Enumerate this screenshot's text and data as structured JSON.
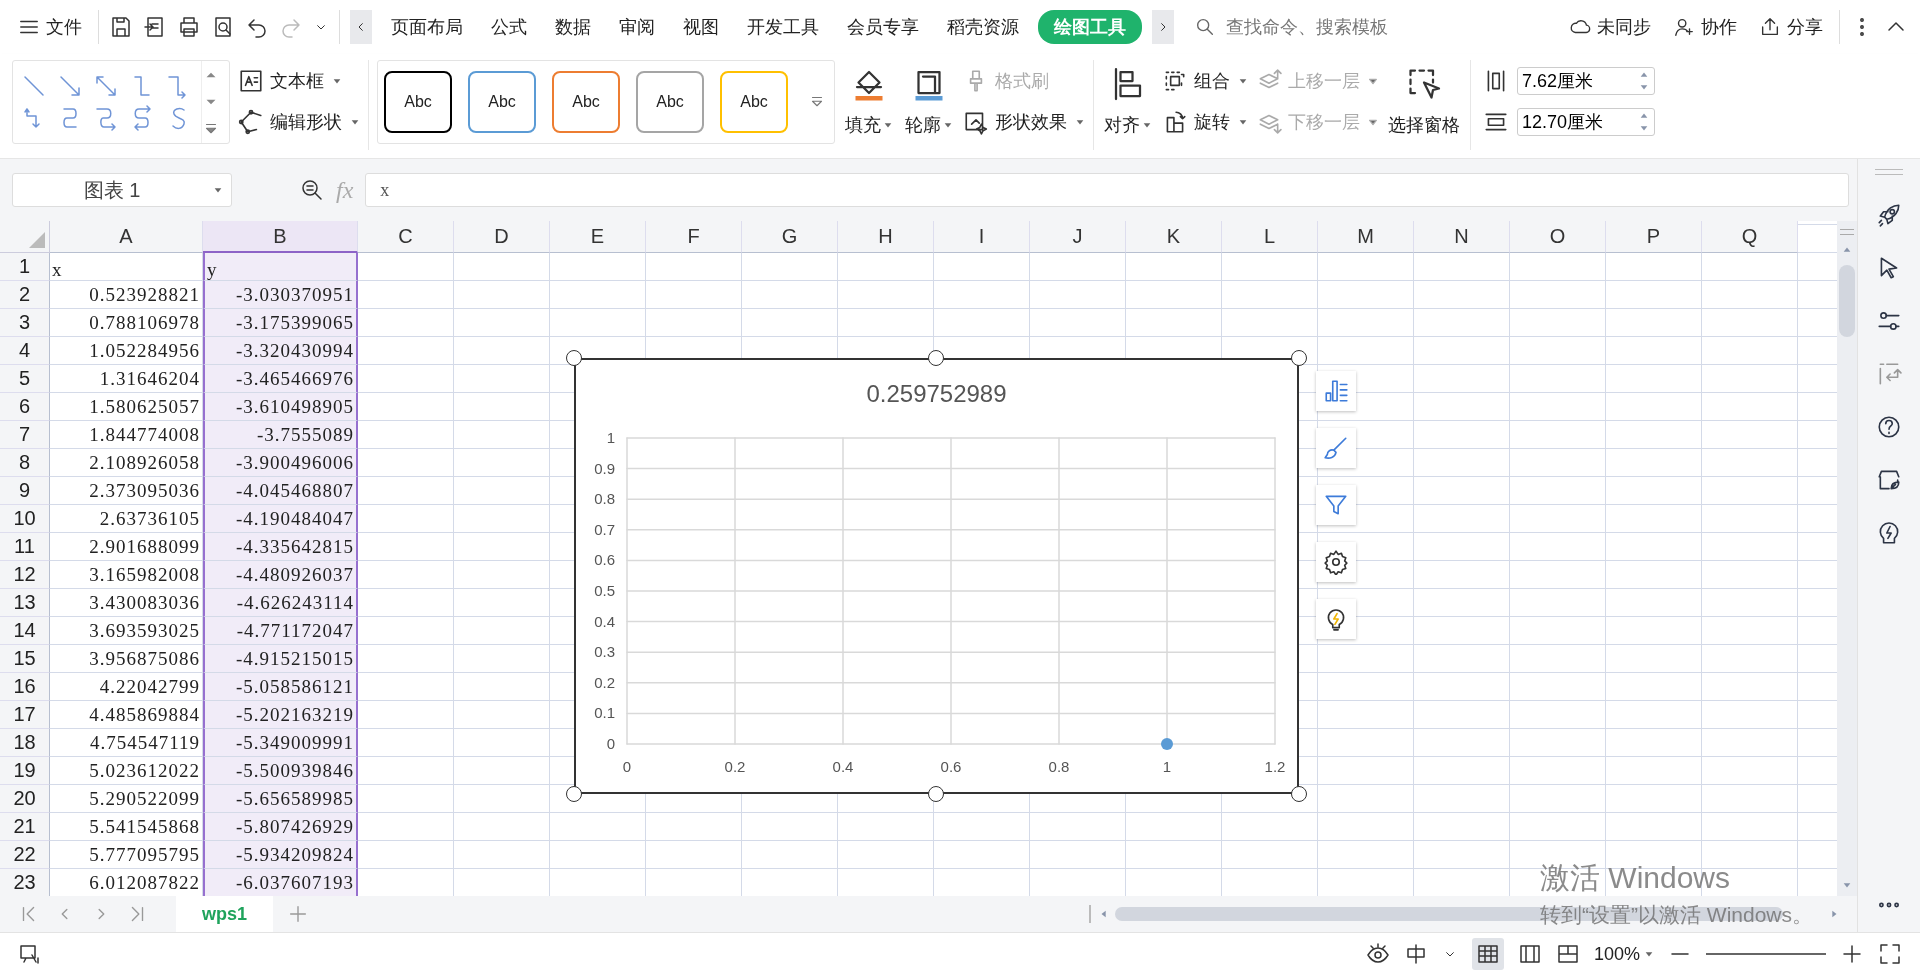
{
  "menu_bar": {
    "file": "文件",
    "tabs": [
      {
        "label": "页面布局",
        "selected": false
      },
      {
        "label": "公式",
        "selected": false
      },
      {
        "label": "数据",
        "selected": false
      },
      {
        "label": "审阅",
        "selected": false
      },
      {
        "label": "视图",
        "selected": false
      },
      {
        "label": "开发工具",
        "selected": false
      },
      {
        "label": "会员专享",
        "selected": false
      },
      {
        "label": "稻壳资源",
        "selected": false
      },
      {
        "label": "绘图工具",
        "selected": true
      }
    ],
    "search": {
      "placeholder": "查找命令、搜索模板"
    },
    "actions": [
      "未同步",
      "协作",
      "分享"
    ]
  },
  "ribbon": {
    "text_box": "文本框",
    "edit_shape": "编辑形状",
    "styles": [
      {
        "label": "Abc",
        "color": "#000000"
      },
      {
        "label": "Abc",
        "color": "#5b9bd5"
      },
      {
        "label": "Abc",
        "color": "#ed7d31"
      },
      {
        "label": "Abc",
        "color": "#a5a5a5"
      },
      {
        "label": "Abc",
        "color": "#ffc000"
      }
    ],
    "fill": "填充",
    "outline": "轮廓",
    "format_painter": {
      "label": "格式刷",
      "disabled": true
    },
    "shape_effects": "形状效果",
    "align": "对齐",
    "group": "组合",
    "rotate": "旋转",
    "bring_forward": {
      "label": "上移一层",
      "disabled": true
    },
    "send_backward": {
      "label": "下移一层",
      "disabled": true
    },
    "selection_pane": "选择窗格",
    "height": "7.62厘米",
    "width": "12.70厘米"
  },
  "formula_bar": {
    "name_box": "图表 1",
    "fx": "fx",
    "value": "x"
  },
  "columns": [
    {
      "label": "A",
      "selected": false
    },
    {
      "label": "B",
      "selected": true
    },
    {
      "label": "C",
      "selected": false
    },
    {
      "label": "D",
      "selected": false
    },
    {
      "label": "E",
      "selected": false
    },
    {
      "label": "F",
      "selected": false
    },
    {
      "label": "G",
      "selected": false
    },
    {
      "label": "H",
      "selected": false
    },
    {
      "label": "I",
      "selected": false
    },
    {
      "label": "J",
      "selected": false
    },
    {
      "label": "K",
      "selected": false
    },
    {
      "label": "L",
      "selected": false
    },
    {
      "label": "M",
      "selected": false
    },
    {
      "label": "N",
      "selected": false
    },
    {
      "label": "O",
      "selected": false
    },
    {
      "label": "P",
      "selected": false
    },
    {
      "label": "Q",
      "selected": false
    }
  ],
  "rows": [
    {
      "number": "1",
      "kind": "text",
      "cells": [
        "x",
        "y"
      ]
    },
    {
      "number": "2",
      "kind": "number",
      "cells": [
        "0.523928821",
        "-3.030370951"
      ]
    },
    {
      "number": "3",
      "kind": "number",
      "cells": [
        "0.788106978",
        "-3.175399065"
      ]
    },
    {
      "number": "4",
      "kind": "number",
      "cells": [
        "1.052284956",
        "-3.320430994"
      ]
    },
    {
      "number": "5",
      "kind": "number",
      "cells": [
        "1.31646204",
        "-3.465466976"
      ]
    },
    {
      "number": "6",
      "kind": "number",
      "cells": [
        "1.580625057",
        "-3.610498905"
      ]
    },
    {
      "number": "7",
      "kind": "number",
      "cells": [
        "1.844774008",
        "-3.7555089"
      ]
    },
    {
      "number": "8",
      "kind": "number",
      "cells": [
        "2.108926058",
        "-3.900496006"
      ]
    },
    {
      "number": "9",
      "kind": "number",
      "cells": [
        "2.373095036",
        "-4.045468807"
      ]
    },
    {
      "number": "10",
      "kind": "number",
      "cells": [
        "2.63736105",
        "-4.190484047"
      ]
    },
    {
      "number": "11",
      "kind": "number",
      "cells": [
        "2.901688099",
        "-4.335642815"
      ]
    },
    {
      "number": "12",
      "kind": "number",
      "cells": [
        "3.165982008",
        "-4.480926037"
      ]
    },
    {
      "number": "13",
      "kind": "number",
      "cells": [
        "3.430083036",
        "-4.626243114"
      ]
    },
    {
      "number": "14",
      "kind": "number",
      "cells": [
        "3.693593025",
        "-4.771172047"
      ]
    },
    {
      "number": "15",
      "kind": "number",
      "cells": [
        "3.956875086",
        "-4.915215015"
      ]
    },
    {
      "number": "16",
      "kind": "number",
      "cells": [
        "4.22042799",
        "-5.058586121"
      ]
    },
    {
      "number": "17",
      "kind": "number",
      "cells": [
        "4.485869884",
        "-5.202163219"
      ]
    },
    {
      "number": "18",
      "kind": "number",
      "cells": [
        "4.754547119",
        "-5.349009991"
      ]
    },
    {
      "number": "19",
      "kind": "number",
      "cells": [
        "5.023612022",
        "-5.500939846"
      ]
    },
    {
      "number": "20",
      "kind": "number",
      "cells": [
        "5.290522099",
        "-5.656589985"
      ]
    },
    {
      "number": "21",
      "kind": "number",
      "cells": [
        "5.541545868",
        "-5.807426929"
      ]
    },
    {
      "number": "22",
      "kind": "number",
      "cells": [
        "5.777095795",
        "-5.934209824"
      ]
    },
    {
      "number": "23",
      "kind": "number",
      "cells": [
        "6.012087822",
        "-6.037607193"
      ]
    }
  ],
  "chart": {
    "chart_data": {
      "type": "scatter",
      "title": "0.259752989",
      "x": [
        1
      ],
      "series": [
        {
          "color": "#5b9bd5",
          "values": [
            0
          ]
        }
      ],
      "xlim": [
        0,
        1.2
      ],
      "ylim": [
        0,
        1
      ],
      "xticks": [
        0,
        0.2,
        0.4,
        0.6,
        0.8,
        1,
        1.2
      ],
      "yticks": [
        0,
        0.1,
        0.2,
        0.3,
        0.4,
        0.5,
        0.6,
        0.7,
        0.8,
        0.9,
        1
      ],
      "grid": true
    }
  },
  "sheet_tabs": [
    {
      "label": "wps1",
      "selected": true
    }
  ],
  "activation_notice": [
    "激活 Windows",
    "转到“设置”以激活 Windows。"
  ],
  "status_bar": {
    "zoom": "100%"
  }
}
